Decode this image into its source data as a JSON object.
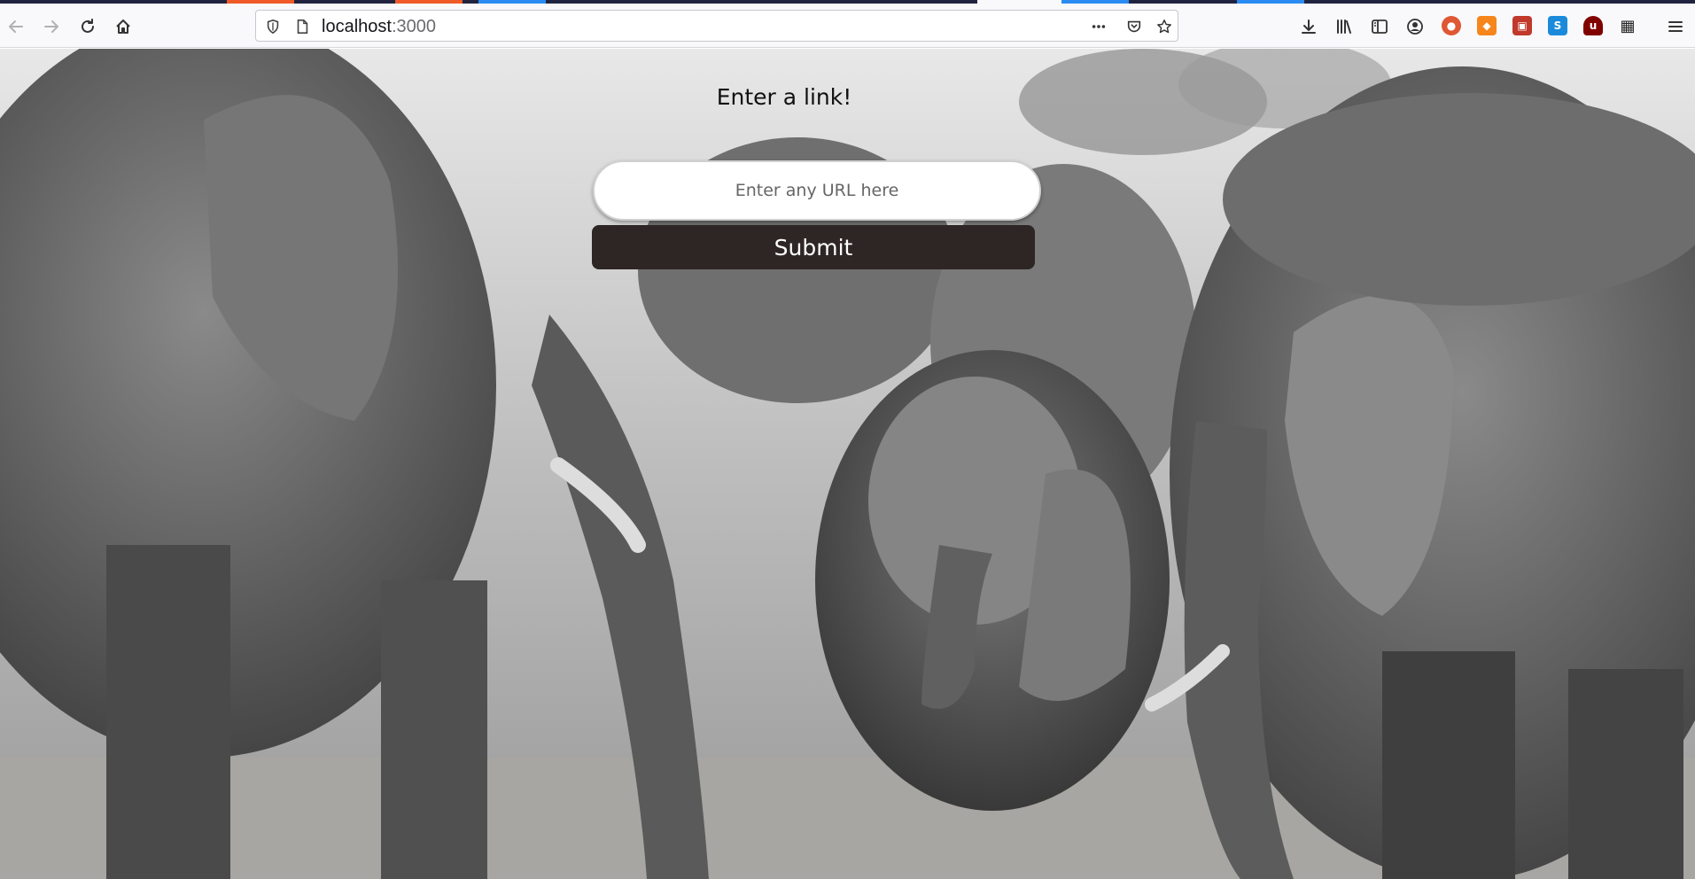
{
  "browser": {
    "url_host": "localhost",
    "url_port": ":3000",
    "tab_colors": [
      "#f05a28",
      "#f05a28",
      "#2a8bf2",
      "#2a8bf2",
      "#2a8bf2"
    ],
    "icons": {
      "back": "back-arrow-icon",
      "forward": "forward-arrow-icon",
      "reload": "reload-icon",
      "home": "home-icon",
      "tracking": "shield-icon",
      "page": "page-icon",
      "page_actions": "more-dots-icon",
      "pocket": "pocket-icon",
      "bookmark": "star-icon",
      "downloads": "download-icon",
      "library": "library-icon",
      "sidebar": "sidebar-icon",
      "account": "account-icon",
      "menu": "hamburger-menu-icon"
    },
    "extensions": [
      {
        "name": "duckduckgo-extension-icon",
        "color": "#de5833",
        "glyph": "●"
      },
      {
        "name": "metamask-extension-icon",
        "color": "#f6851b",
        "glyph": "◆"
      },
      {
        "name": "red-extension-icon",
        "color": "#c0392b",
        "glyph": "▣"
      },
      {
        "name": "s-extension-icon",
        "color": "#1c8adb",
        "glyph": "S"
      },
      {
        "name": "ublock-extension-icon",
        "color": "#800000",
        "glyph": "u"
      },
      {
        "name": "grid-extension-icon",
        "color": "#222222",
        "glyph": "▦"
      }
    ]
  },
  "page": {
    "title": "Enter a link!",
    "input_placeholder": "Enter any URL here",
    "submit_label": "Submit",
    "background": "black-and-white-elephant-herd-photo"
  }
}
